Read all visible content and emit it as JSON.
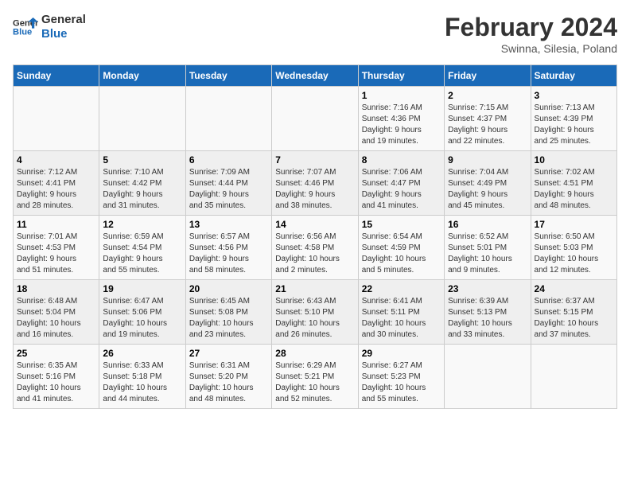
{
  "header": {
    "logo_line1": "General",
    "logo_line2": "Blue",
    "month_title": "February 2024",
    "location": "Swinna, Silesia, Poland"
  },
  "weekdays": [
    "Sunday",
    "Monday",
    "Tuesday",
    "Wednesday",
    "Thursday",
    "Friday",
    "Saturday"
  ],
  "weeks": [
    [
      {
        "day": "",
        "info": ""
      },
      {
        "day": "",
        "info": ""
      },
      {
        "day": "",
        "info": ""
      },
      {
        "day": "",
        "info": ""
      },
      {
        "day": "1",
        "info": "Sunrise: 7:16 AM\nSunset: 4:36 PM\nDaylight: 9 hours\nand 19 minutes."
      },
      {
        "day": "2",
        "info": "Sunrise: 7:15 AM\nSunset: 4:37 PM\nDaylight: 9 hours\nand 22 minutes."
      },
      {
        "day": "3",
        "info": "Sunrise: 7:13 AM\nSunset: 4:39 PM\nDaylight: 9 hours\nand 25 minutes."
      }
    ],
    [
      {
        "day": "4",
        "info": "Sunrise: 7:12 AM\nSunset: 4:41 PM\nDaylight: 9 hours\nand 28 minutes."
      },
      {
        "day": "5",
        "info": "Sunrise: 7:10 AM\nSunset: 4:42 PM\nDaylight: 9 hours\nand 31 minutes."
      },
      {
        "day": "6",
        "info": "Sunrise: 7:09 AM\nSunset: 4:44 PM\nDaylight: 9 hours\nand 35 minutes."
      },
      {
        "day": "7",
        "info": "Sunrise: 7:07 AM\nSunset: 4:46 PM\nDaylight: 9 hours\nand 38 minutes."
      },
      {
        "day": "8",
        "info": "Sunrise: 7:06 AM\nSunset: 4:47 PM\nDaylight: 9 hours\nand 41 minutes."
      },
      {
        "day": "9",
        "info": "Sunrise: 7:04 AM\nSunset: 4:49 PM\nDaylight: 9 hours\nand 45 minutes."
      },
      {
        "day": "10",
        "info": "Sunrise: 7:02 AM\nSunset: 4:51 PM\nDaylight: 9 hours\nand 48 minutes."
      }
    ],
    [
      {
        "day": "11",
        "info": "Sunrise: 7:01 AM\nSunset: 4:53 PM\nDaylight: 9 hours\nand 51 minutes."
      },
      {
        "day": "12",
        "info": "Sunrise: 6:59 AM\nSunset: 4:54 PM\nDaylight: 9 hours\nand 55 minutes."
      },
      {
        "day": "13",
        "info": "Sunrise: 6:57 AM\nSunset: 4:56 PM\nDaylight: 9 hours\nand 58 minutes."
      },
      {
        "day": "14",
        "info": "Sunrise: 6:56 AM\nSunset: 4:58 PM\nDaylight: 10 hours\nand 2 minutes."
      },
      {
        "day": "15",
        "info": "Sunrise: 6:54 AM\nSunset: 4:59 PM\nDaylight: 10 hours\nand 5 minutes."
      },
      {
        "day": "16",
        "info": "Sunrise: 6:52 AM\nSunset: 5:01 PM\nDaylight: 10 hours\nand 9 minutes."
      },
      {
        "day": "17",
        "info": "Sunrise: 6:50 AM\nSunset: 5:03 PM\nDaylight: 10 hours\nand 12 minutes."
      }
    ],
    [
      {
        "day": "18",
        "info": "Sunrise: 6:48 AM\nSunset: 5:04 PM\nDaylight: 10 hours\nand 16 minutes."
      },
      {
        "day": "19",
        "info": "Sunrise: 6:47 AM\nSunset: 5:06 PM\nDaylight: 10 hours\nand 19 minutes."
      },
      {
        "day": "20",
        "info": "Sunrise: 6:45 AM\nSunset: 5:08 PM\nDaylight: 10 hours\nand 23 minutes."
      },
      {
        "day": "21",
        "info": "Sunrise: 6:43 AM\nSunset: 5:10 PM\nDaylight: 10 hours\nand 26 minutes."
      },
      {
        "day": "22",
        "info": "Sunrise: 6:41 AM\nSunset: 5:11 PM\nDaylight: 10 hours\nand 30 minutes."
      },
      {
        "day": "23",
        "info": "Sunrise: 6:39 AM\nSunset: 5:13 PM\nDaylight: 10 hours\nand 33 minutes."
      },
      {
        "day": "24",
        "info": "Sunrise: 6:37 AM\nSunset: 5:15 PM\nDaylight: 10 hours\nand 37 minutes."
      }
    ],
    [
      {
        "day": "25",
        "info": "Sunrise: 6:35 AM\nSunset: 5:16 PM\nDaylight: 10 hours\nand 41 minutes."
      },
      {
        "day": "26",
        "info": "Sunrise: 6:33 AM\nSunset: 5:18 PM\nDaylight: 10 hours\nand 44 minutes."
      },
      {
        "day": "27",
        "info": "Sunrise: 6:31 AM\nSunset: 5:20 PM\nDaylight: 10 hours\nand 48 minutes."
      },
      {
        "day": "28",
        "info": "Sunrise: 6:29 AM\nSunset: 5:21 PM\nDaylight: 10 hours\nand 52 minutes."
      },
      {
        "day": "29",
        "info": "Sunrise: 6:27 AM\nSunset: 5:23 PM\nDaylight: 10 hours\nand 55 minutes."
      },
      {
        "day": "",
        "info": ""
      },
      {
        "day": "",
        "info": ""
      }
    ]
  ]
}
